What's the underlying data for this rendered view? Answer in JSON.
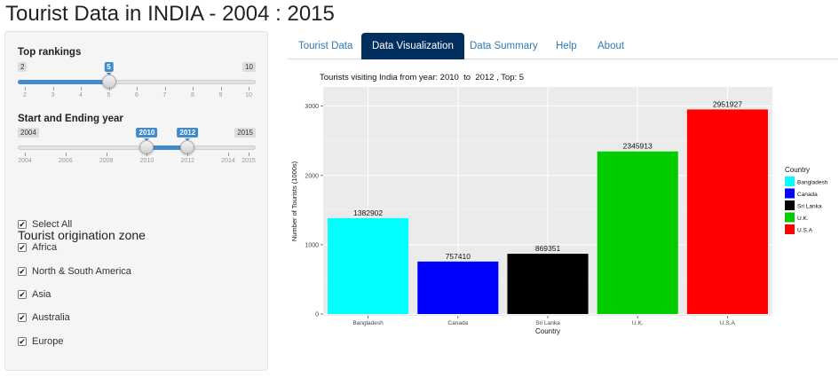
{
  "page": {
    "title": "Tourist Data in INDIA - 2004 : 2015"
  },
  "sidebar": {
    "rankings": {
      "label": "Top rankings",
      "min_label": "2",
      "max_label": "10",
      "value_label": "5",
      "min": 2,
      "max": 10,
      "value": 5,
      "ticks": [
        "2",
        "3",
        "4",
        "5",
        "6",
        "7",
        "8",
        "9",
        "10"
      ]
    },
    "years": {
      "label": "Start and Ending year",
      "min_label": "2004",
      "max_label": "2015",
      "from_label": "2010",
      "to_label": "2012",
      "min": 2004,
      "max": 2015,
      "from": 2010,
      "to": 2012,
      "ticks": [
        "2004",
        "2006",
        "2008",
        "2010",
        "2012",
        "2014",
        "2015"
      ]
    },
    "zone": {
      "title": "Tourist origination zone",
      "options": [
        {
          "label": "Select All",
          "checked": true
        },
        {
          "label": "Africa",
          "checked": true
        },
        {
          "label": "North & South America",
          "checked": true
        },
        {
          "label": "Asia",
          "checked": true
        },
        {
          "label": "Australia",
          "checked": true
        },
        {
          "label": "Europe",
          "checked": true
        }
      ]
    }
  },
  "tabs": [
    {
      "label": "Tourist Data",
      "active": false
    },
    {
      "label": "Data Visualization",
      "active": true
    },
    {
      "label": "Data Summary",
      "active": false
    },
    {
      "label": "Help",
      "active": false
    },
    {
      "label": "About",
      "active": false
    }
  ],
  "chart_data": {
    "type": "bar",
    "title": "Tourists visiting India from year: 2010  to  2012 , Top: 5",
    "xlabel": "Country",
    "ylabel": "Number of Tourists (1000s)",
    "categories": [
      "Bangladesh",
      "Canada",
      "Sri Lanka",
      "U.K.",
      "U.S.A"
    ],
    "values": [
      1382902,
      757410,
      869351,
      2345913,
      2951927
    ],
    "colors": [
      "#00ffff",
      "#0000ff",
      "#000000",
      "#00cc00",
      "#ff0000"
    ],
    "ylim": [
      0,
      3000000
    ],
    "yticks": [
      0,
      1000000,
      2000000,
      3000000
    ],
    "ytick_labels": [
      "0",
      "1000",
      "2000",
      "3000"
    ],
    "legend_title": "Country",
    "legend_position": "right",
    "grid": true
  }
}
